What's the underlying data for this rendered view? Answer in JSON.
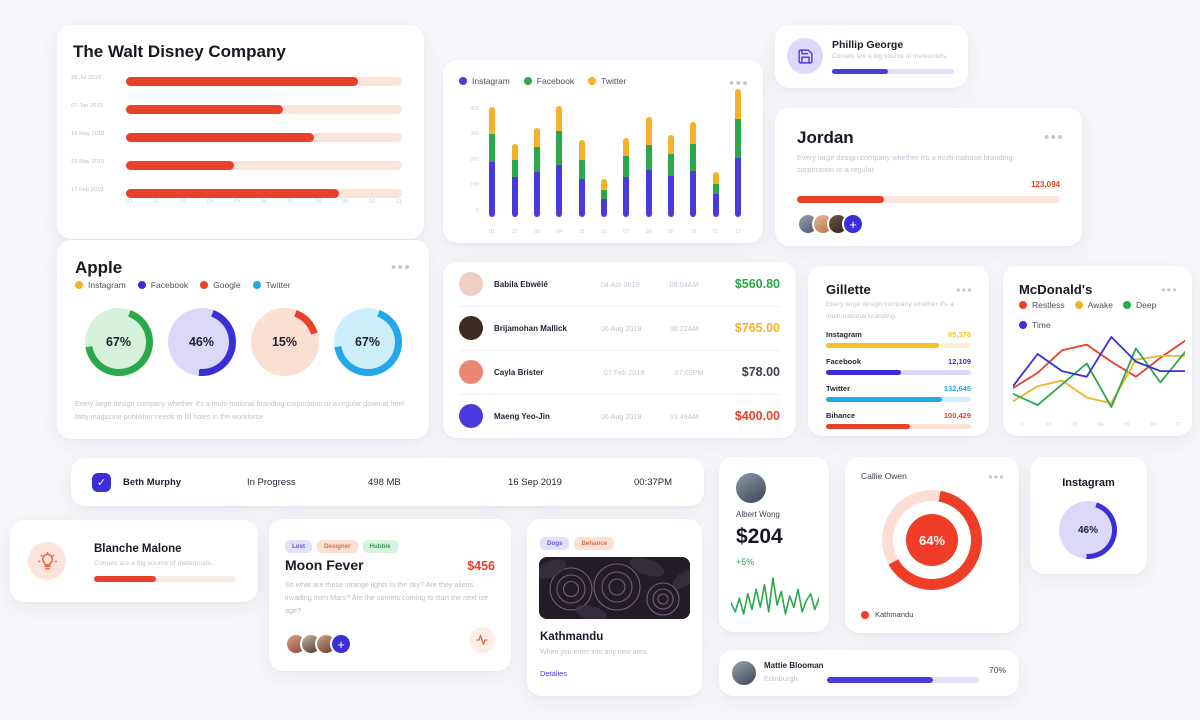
{
  "disney": {
    "title": "The Walt Disney Company",
    "rows": [
      {
        "label": "28 Jul 2019",
        "pct": 84
      },
      {
        "label": "07 Jan 2019",
        "pct": 57
      },
      {
        "label": "16 May 2019",
        "pct": 68
      },
      {
        "label": "23 May 2019",
        "pct": 39
      },
      {
        "label": "17 Feb 2019",
        "pct": 77
      }
    ],
    "xticks": [
      "01",
      "02",
      "03",
      "04",
      "05",
      "06",
      "07",
      "08",
      "09",
      "10",
      "11"
    ],
    "colors": {
      "fill": "#e8402a",
      "track": "#fde4db"
    }
  },
  "bars": {
    "menu": "•••",
    "legend": [
      {
        "label": "Instagram",
        "color": "#4a3ade"
      },
      {
        "label": "Facebook",
        "color": "#2aa84a"
      },
      {
        "label": "Twitter",
        "color": "#f5b12a"
      }
    ],
    "chart_data": {
      "type": "bar",
      "title": "",
      "xlabel": "",
      "ylabel": "",
      "ylim": [
        0,
        450
      ],
      "yticks": [
        0,
        100,
        200,
        300,
        400
      ],
      "grid": false,
      "legend_position": "top-left",
      "categories": [
        "01",
        "02",
        "03",
        "04",
        "05",
        "06",
        "07",
        "08",
        "09",
        "10",
        "11",
        "12"
      ],
      "series": [
        {
          "name": "Instagram",
          "color": "#4a3ade",
          "values": [
            215,
            155,
            175,
            205,
            150,
            70,
            155,
            185,
            160,
            180,
            90,
            230
          ]
        },
        {
          "name": "Facebook",
          "color": "#2aa84a",
          "values": [
            110,
            70,
            100,
            130,
            75,
            35,
            85,
            95,
            85,
            105,
            40,
            155
          ]
        },
        {
          "name": "Twitter",
          "color": "#f5b12a",
          "values": [
            105,
            60,
            75,
            100,
            75,
            45,
            70,
            110,
            75,
            85,
            45,
            115
          ]
        }
      ]
    }
  },
  "phillip": {
    "name": "Phillip George",
    "desc": "Comets are a big source of meteoroids.",
    "progress": 46,
    "icon": "save-icon"
  },
  "jordan": {
    "title": "Jordan",
    "menu": "•••",
    "desc": "Every large design company whether it's a multi-national branding corporation or a regular.",
    "value": "123,094",
    "progress": 33,
    "add_label": "+"
  },
  "apple": {
    "title": "Apple",
    "menu": "•••",
    "legend": [
      {
        "label": "Instagram",
        "color": "#f5b12a"
      },
      {
        "label": "Facebook",
        "color": "#3a2fd6"
      },
      {
        "label": "Google",
        "color": "#e8402a"
      },
      {
        "label": "Twitter",
        "color": "#22a8e8"
      }
    ],
    "chart_data": {
      "type": "pie",
      "title": "Apple",
      "legend_position": "top",
      "donuts": [
        {
          "label": "67%",
          "value": 67,
          "color": "#2aa84a",
          "bg": "#d6f2dc"
        },
        {
          "label": "46%",
          "value": 46,
          "color": "#3a2fd6",
          "bg": "#dcd8fa"
        },
        {
          "label": "15%",
          "value": 15,
          "color": "#e8402a",
          "bg": "#fbdfd0"
        },
        {
          "label": "67%",
          "value": 67,
          "color": "#22a8e8",
          "bg": "#cdeffb"
        }
      ]
    },
    "footnote": "Every large design company whether it's a multi-national branding corporation or a regular down at heel tatty magazine publisher needs to fill holes in the workforce."
  },
  "transactions": {
    "rows": [
      {
        "name": "Babila Ebwélé",
        "date": "04 Apr 2019",
        "time": "09:04AM",
        "amount": "$560.80",
        "color": "#2aa84a",
        "av": "#f0cfc2"
      },
      {
        "name": "Brijamohan Mallick",
        "date": "06 Aug 2019",
        "time": "08:22AM",
        "amount": "$765.00",
        "color": "#f5b12a",
        "av": "#3b2b22"
      },
      {
        "name": "Cayla Brister",
        "date": "07 Feb 2019",
        "time": "07:02PM",
        "amount": "$78.00",
        "color": "#3b3f4e",
        "av": "#e9876f"
      },
      {
        "name": "Maeng Yeo-Jin",
        "date": "06 Aug 2019",
        "time": "03:49AM",
        "amount": "$400.00",
        "color": "#e8402a",
        "av": "#4a3ade"
      }
    ]
  },
  "gillette": {
    "title": "Gillette",
    "menu": "•••",
    "desc": "Every large design company whether it's a multi-national branding.",
    "chart_data": {
      "type": "bar",
      "title": "Gillette",
      "categories": [
        "Instagram",
        "Facebook",
        "Twitter",
        "Bihance"
      ],
      "values": [
        65376,
        12109,
        132645,
        100429
      ],
      "labels": [
        "65,376",
        "12,109",
        "132,645",
        "100,429"
      ],
      "percents": [
        78,
        52,
        80,
        58
      ],
      "colors": [
        "#f5c126",
        "#3a2fd6",
        "#22a8e8",
        "#e8402a"
      ],
      "tracks": [
        "#fbf0cf",
        "#ded9f9",
        "#d2eefb",
        "#fbe3d8"
      ]
    }
  },
  "mcdonalds": {
    "title": "McDonald's",
    "menu": "•••",
    "legend": [
      {
        "label": "Restless",
        "color": "#e8402a"
      },
      {
        "label": "Awake",
        "color": "#f0b429"
      },
      {
        "label": "Deep",
        "color": "#2aa84a"
      },
      {
        "label": "Time",
        "color": "#3a2fd6"
      }
    ],
    "chart_data": {
      "type": "line",
      "title": "McDonald's",
      "x": [
        "01",
        "02",
        "03",
        "04",
        "05",
        "06",
        "07"
      ],
      "grid": false,
      "legend_position": "top",
      "series": [
        {
          "name": "Restless",
          "color": "#e8402a",
          "values": [
            28,
            44,
            68,
            74,
            56,
            40,
            60,
            78
          ]
        },
        {
          "name": "Awake",
          "color": "#f0b429",
          "values": [
            14,
            30,
            36,
            18,
            12,
            58,
            62,
            62
          ]
        },
        {
          "name": "Deep",
          "color": "#2aa84a",
          "values": [
            22,
            10,
            32,
            54,
            8,
            70,
            34,
            66
          ]
        },
        {
          "name": "Time",
          "color": "#3a2fd6",
          "values": [
            30,
            64,
            46,
            40,
            82,
            56,
            46,
            46
          ]
        }
      ]
    }
  },
  "beth": {
    "checked": true,
    "check_glyph": "✓",
    "cells": [
      "Beth Murphy",
      "In Progress",
      "498 MB",
      "16 Sep 2019",
      "00:37PM"
    ]
  },
  "blanche": {
    "name": "Blanche Malone",
    "desc": "Comets are a big source of meteoroids.",
    "progress": 44,
    "icon": "lightbulb-icon"
  },
  "moon": {
    "tags": [
      {
        "label": "Lost",
        "bg": "#e3e0fb",
        "fg": "#6257d8"
      },
      {
        "label": "Designer",
        "bg": "#fbe1d4",
        "fg": "#d9714a"
      },
      {
        "label": "Hubble",
        "bg": "#d8f3dd",
        "fg": "#3a9a55"
      }
    ],
    "title": "Moon Fever",
    "price": "$456",
    "desc": "So what are these strange lights in the sky? Are they aliens invading from Mars? Are the comets coming to start the next ice age?",
    "add_label": "+",
    "icon": "activity-icon"
  },
  "kathmandu": {
    "tags": [
      {
        "label": "Dogs",
        "bg": "#e3e0fb",
        "fg": "#6257d8"
      },
      {
        "label": "Behance",
        "bg": "#fbe1d4",
        "fg": "#d9714a"
      }
    ],
    "title": "Kathmandu",
    "desc": "When you enter into any new area.",
    "link": "Detalies"
  },
  "albert": {
    "name": "Albert Wong",
    "amount": "$204",
    "change": "+5%",
    "change_color": "#2aa84a",
    "spark": [
      18,
      10,
      22,
      8,
      26,
      12,
      30,
      14,
      34,
      10,
      40,
      16,
      28,
      8,
      24,
      14,
      30,
      10,
      20,
      26,
      12,
      22
    ]
  },
  "callie": {
    "title": "Callie Owen",
    "menu": "•••",
    "value": "64%",
    "percent": 64,
    "legend_label": "Kathmandu",
    "color": "#ef3d27",
    "track": "#fbdfd5"
  },
  "instagram": {
    "title": "Instagram",
    "value": "46%",
    "percent": 46,
    "color": "#3a2fd6",
    "bg": "#dcd8fa"
  },
  "mattie": {
    "name": "Mattie Blooman",
    "city": "Edinburgh",
    "percent_label": "70%",
    "progress": 70
  }
}
